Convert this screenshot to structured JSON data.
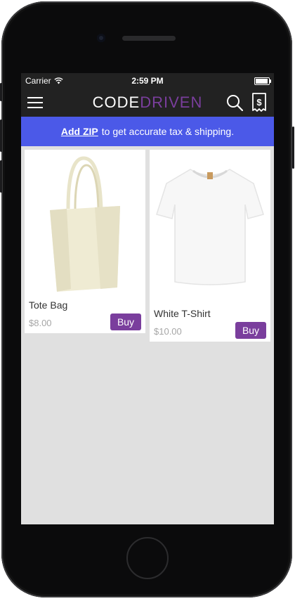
{
  "status_bar": {
    "carrier": "Carrier",
    "time": "2:59 PM"
  },
  "nav": {
    "brand_part1": "CODE",
    "brand_part2": "DRIVEN"
  },
  "banner": {
    "link_text": "Add ZIP",
    "text": "to get accurate tax & shipping."
  },
  "products": [
    {
      "name": "Tote Bag",
      "price": "$8.00",
      "buy_label": "Buy"
    },
    {
      "name": "White T-Shirt",
      "price": "$10.00",
      "buy_label": "Buy"
    }
  ],
  "colors": {
    "brand_purple": "#7a3e9d",
    "banner_blue": "#4b59e8",
    "bar_dark": "#222222",
    "content_gray": "#e0e0e0"
  }
}
